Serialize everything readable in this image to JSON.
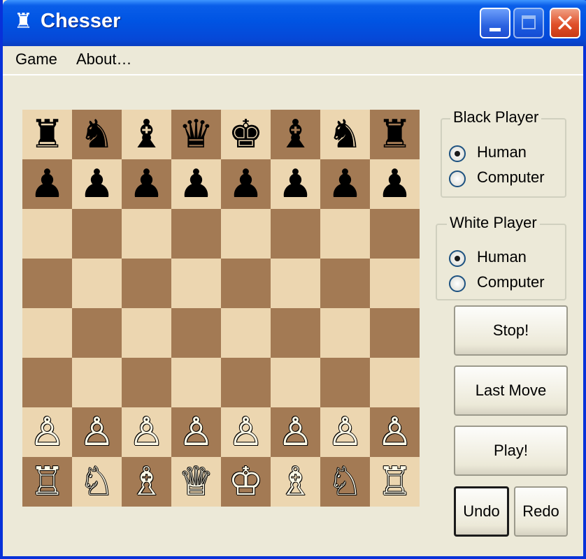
{
  "window": {
    "title": "Chesser",
    "app_icon": "rook-icon",
    "controls": {
      "minimize": "minimize-icon",
      "maximize": "maximize-icon",
      "close": "close-icon",
      "close_glyph": "✕"
    }
  },
  "menu": {
    "game": "Game",
    "about": "About…"
  },
  "board": {
    "colors": {
      "light": "#ecd6b0",
      "dark": "#a37a54"
    },
    "ranks": [
      [
        "r",
        "n",
        "b",
        "q",
        "k",
        "b",
        "n",
        "r"
      ],
      [
        "p",
        "p",
        "p",
        "p",
        "p",
        "p",
        "p",
        "p"
      ],
      [
        "",
        "",
        "",
        "",
        "",
        "",
        "",
        ""
      ],
      [
        "",
        "",
        "",
        "",
        "",
        "",
        "",
        ""
      ],
      [
        "",
        "",
        "",
        "",
        "",
        "",
        "",
        ""
      ],
      [
        "",
        "",
        "",
        "",
        "",
        "",
        "",
        ""
      ],
      [
        "P",
        "P",
        "P",
        "P",
        "P",
        "P",
        "P",
        "P"
      ],
      [
        "R",
        "N",
        "B",
        "Q",
        "K",
        "B",
        "N",
        "R"
      ]
    ],
    "glyphs": {
      "k": "♚",
      "q": "♛",
      "r": "♜",
      "b": "♝",
      "n": "♞",
      "p": "♟",
      "K": "♔",
      "Q": "♕",
      "R": "♖",
      "B": "♗",
      "N": "♘",
      "P": "♙"
    },
    "names": {
      "k": "black-king",
      "q": "black-queen",
      "r": "black-rook",
      "b": "black-bishop",
      "n": "black-knight",
      "p": "black-pawn",
      "K": "white-king",
      "Q": "white-queen",
      "R": "white-rook",
      "B": "white-bishop",
      "N": "white-knight",
      "P": "white-pawn"
    }
  },
  "black_player": {
    "title": "Black Player",
    "options": [
      "Human",
      "Computer"
    ],
    "selected": "Human"
  },
  "white_player": {
    "title": "White Player",
    "options": [
      "Human",
      "Computer"
    ],
    "selected": "Human"
  },
  "buttons": {
    "stop": "Stop!",
    "last_move": "Last Move",
    "play": "Play!",
    "undo": "Undo",
    "redo": "Redo"
  }
}
